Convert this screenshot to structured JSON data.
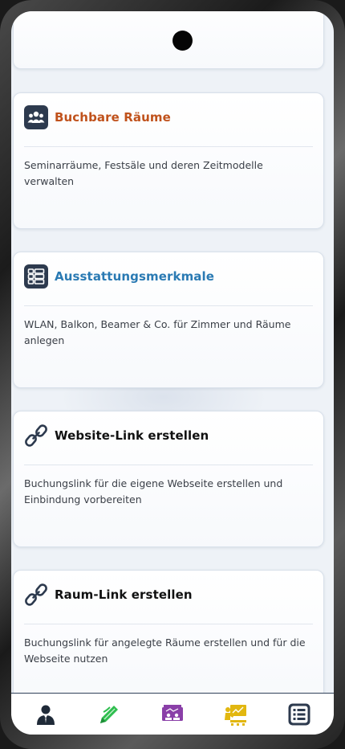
{
  "cards": [
    {
      "title": "Buchbare Räume",
      "description": "Seminarräume, Festsäle und deren Zeitmodelle verwalten",
      "title_color": "#c0521c",
      "icon": "group-icon"
    },
    {
      "title": "Ausstattungsmerkmale",
      "description": "WLAN, Balkon, Beamer & Co. für Zimmer und Räume anlegen",
      "title_color": "#2a7ab3",
      "icon": "feature-list-icon"
    },
    {
      "title": "Website-Link erstellen",
      "description": "Buchungslink für die eigene Webseite erstellen und Einbindung vorbereiten",
      "title_color": "#111111",
      "icon": "link-icon"
    },
    {
      "title": "Raum-Link erstellen",
      "description": "Buchungslink für angelegte Räume erstellen und für die Webseite nutzen",
      "title_color": "#111111",
      "icon": "link-icon"
    }
  ],
  "tabbar": {
    "items": [
      {
        "icon": "user-icon",
        "color": "#1f2a38"
      },
      {
        "icon": "pencil-icon",
        "color": "#2fbe4f"
      },
      {
        "icon": "room-presentation-icon",
        "color": "#8a3fa8"
      },
      {
        "icon": "presenter-icon",
        "color": "#e2b710"
      },
      {
        "icon": "list-icon",
        "color": "#2d3a4e"
      }
    ]
  },
  "colors": {
    "icon_tile": "#2d3a4e",
    "background": "#eef2f7"
  }
}
